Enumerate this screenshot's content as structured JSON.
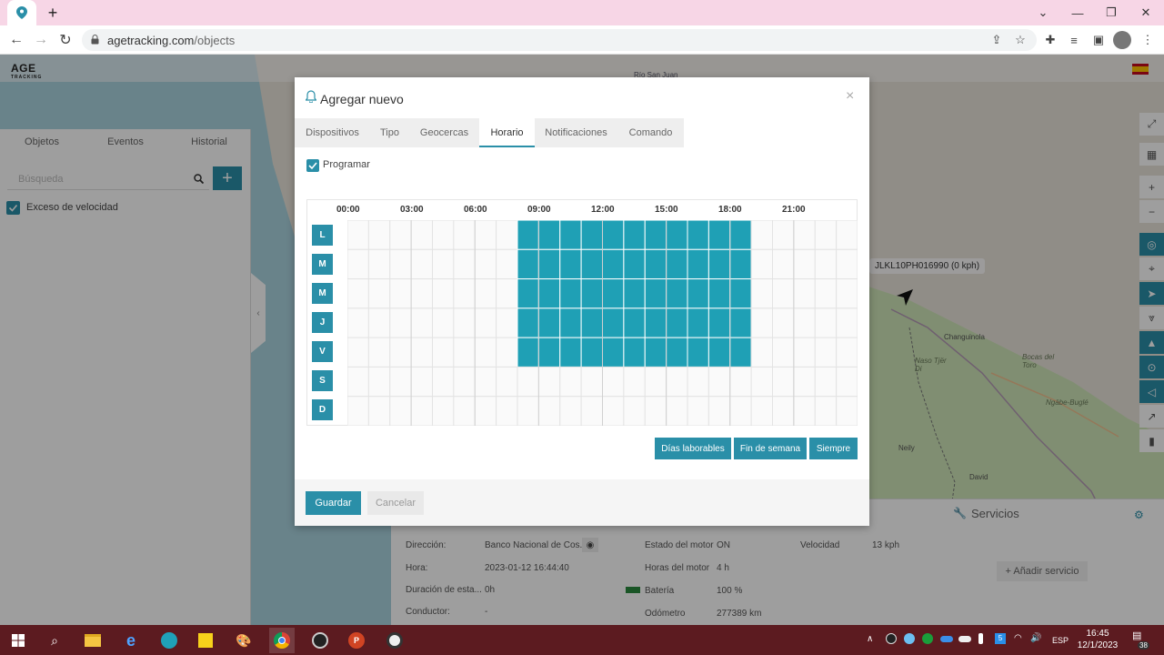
{
  "browser": {
    "url_domain": "agetracking.com",
    "url_path": "/objects"
  },
  "app": {
    "logo_text": "AGE",
    "logo_sub": "TRACKING",
    "sidebar_tabs": [
      "Objetos",
      "Eventos",
      "Historial"
    ],
    "search_placeholder": "Búsqueda",
    "events": [
      {
        "label": "Exceso de velocidad",
        "checked": true
      }
    ],
    "map_labels": {
      "vehicle": "JLKL10PH016990 (0 kph)",
      "river": "Río San Juan",
      "towns": [
        "Changuinola",
        "Naso Tjër Di",
        "Bocas del Toro",
        "Ngäbe-Buglé",
        "Neily",
        "David"
      ]
    },
    "info": {
      "left": [
        {
          "label": "Dirección:",
          "value": "Banco Nacional de Cos..."
        },
        {
          "label": "Hora:",
          "value": "2023-01-12 16:44:40"
        },
        {
          "label": "Duración de esta...",
          "value": "0h"
        },
        {
          "label": "Conductor:",
          "value": "-"
        }
      ],
      "middle": [
        {
          "label": "Estado del motor",
          "value": "ON"
        },
        {
          "label": "Horas del motor",
          "value": "4 h"
        },
        {
          "label": "Batería",
          "value": "100 %"
        },
        {
          "label": "Odómetro",
          "value": "277389 km"
        }
      ],
      "speed": {
        "label": "Velocidad",
        "value": "13 kph"
      }
    },
    "services_title": "Servicios",
    "add_service": "+ Añadir servicio"
  },
  "modal": {
    "title": "Agregar nuevo",
    "tabs": [
      {
        "label": "Dispositivos",
        "active": false
      },
      {
        "label": "Tipo",
        "active": false
      },
      {
        "label": "Geocercas",
        "active": false
      },
      {
        "label": "Horario",
        "active": true
      },
      {
        "label": "Notificaciones",
        "active": false
      },
      {
        "label": "Comando",
        "active": false
      }
    ],
    "program_label": "Programar",
    "program_checked": true,
    "hours": [
      "00:00",
      "03:00",
      "06:00",
      "09:00",
      "12:00",
      "15:00",
      "18:00",
      "21:00"
    ],
    "days": [
      "L",
      "M",
      "M",
      "J",
      "V",
      "S",
      "D"
    ],
    "schedule": {
      "slots_per_day": 24,
      "selected_days": [
        0,
        1,
        2,
        3,
        4
      ],
      "selected_start_hour": 8,
      "selected_end_hour": 19
    },
    "quick_buttons": [
      "Días laborables",
      "Fin de semana",
      "Siempre"
    ],
    "save_label": "Guardar",
    "cancel_label": "Cancelar"
  },
  "taskbar": {
    "lang": "ESP",
    "time": "16:45",
    "date": "12/1/2023",
    "notification_count": "38"
  },
  "colors": {
    "accent": "#2a8fa8",
    "cell_selected": "#1fa0b5"
  }
}
